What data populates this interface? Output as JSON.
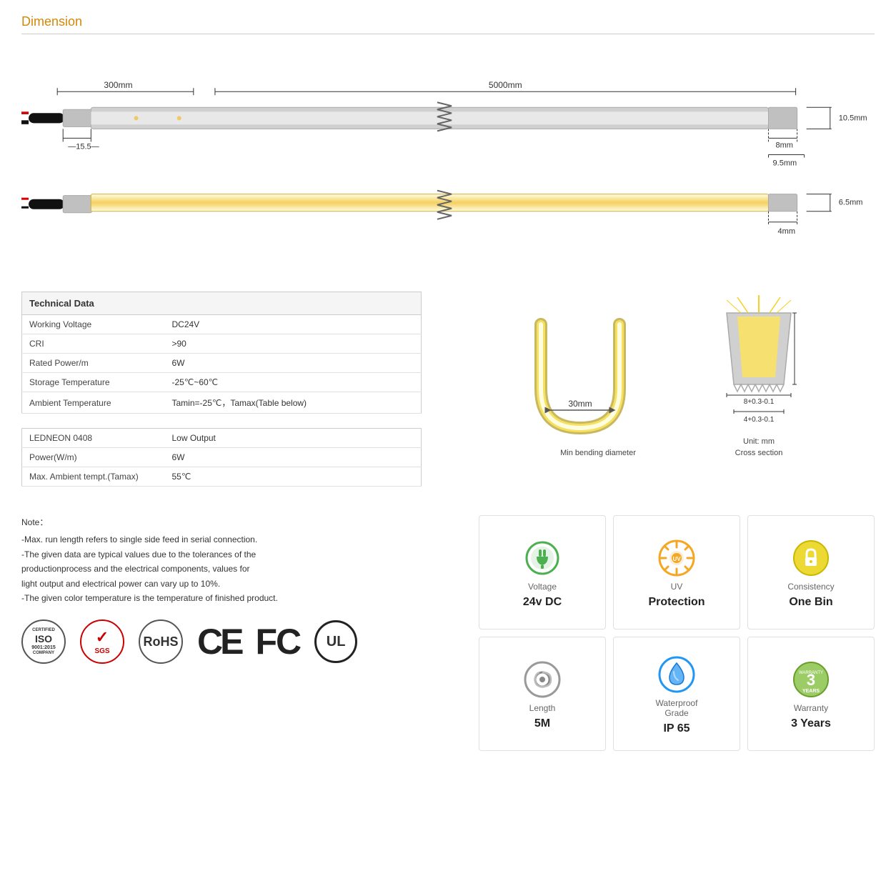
{
  "title": "Dimension",
  "dimension": {
    "measurements": {
      "top_300mm": "300mm",
      "top_5000mm": "5000mm",
      "height_10_5": "10.5mm",
      "width_8": "8mm",
      "width_9_5": "9.5mm",
      "bottom_15_5": "15.5",
      "height_6_5": "6.5mm",
      "width_4": "4mm"
    }
  },
  "technical_table1": {
    "title": "Technical Data",
    "rows": [
      {
        "label": "Working Voltage",
        "value": "DC24V"
      },
      {
        "label": "CRI",
        "value": ">90"
      },
      {
        "label": "Rated Power/m",
        "value": "6W"
      },
      {
        "label": "Storage Temperature",
        "value": "-25℃~60℃"
      },
      {
        "label": "Ambient Temperature",
        "value": "Tamin=-25℃，Tamax(Table below)"
      }
    ]
  },
  "technical_table2": {
    "rows": [
      {
        "label": "LEDNEON 0408",
        "value": "Low Output"
      },
      {
        "label": "Power(W/m)",
        "value": "6W"
      },
      {
        "label": "Max. Ambient tempt.(Tamax)",
        "value": "55℃"
      }
    ]
  },
  "bending": {
    "diameter_label": "30mm",
    "caption": "Min bending diameter",
    "cross_section": {
      "caption1": "Unit: mm",
      "caption2": "Cross section",
      "dim1": "8+0.3-0.1",
      "dim2": "4+0.3-0.1"
    }
  },
  "notes": {
    "title": "Note：",
    "lines": [
      "-Max. run length refers to single side feed in serial connection.",
      "-The given data are typical values due to the tolerances of the",
      "  productionprocess and the electrical components, values for",
      "  light output and electrical power can vary up to 10%.",
      "-The given color temperature is the temperature of finished product."
    ]
  },
  "certifications": [
    {
      "id": "iso",
      "lines": [
        "CERTIFIED",
        "ISO",
        "9001:2015",
        "COMPANY"
      ]
    },
    {
      "id": "sgs",
      "lines": [
        "✓",
        "SGS"
      ]
    },
    {
      "id": "rohs",
      "lines": [
        "RoHS"
      ]
    },
    {
      "id": "ce",
      "text": "CE"
    },
    {
      "id": "fc",
      "text": "FC"
    },
    {
      "id": "ul",
      "text": "UL"
    }
  ],
  "badges": {
    "row1": [
      {
        "icon": "plug",
        "icon_color": "#4caf50",
        "label": "Voltage",
        "value": "24v DC"
      },
      {
        "icon": "uv",
        "icon_color": "#f5a623",
        "label": "UV Protection",
        "value": "Protection"
      },
      {
        "icon": "consistency",
        "icon_color": "#e6c200",
        "label": "Consistency",
        "value": "One Bin"
      }
    ],
    "row2": [
      {
        "icon": "length",
        "icon_color": "#888",
        "label": "Length",
        "value": "5M"
      },
      {
        "icon": "waterproof",
        "icon_color": "#2196f3",
        "label": "Waterproof Grade",
        "value": "IP 65"
      },
      {
        "icon": "warranty",
        "icon_color": "#8bc34a",
        "label": "Warranty",
        "value": "3 Years"
      }
    ]
  }
}
